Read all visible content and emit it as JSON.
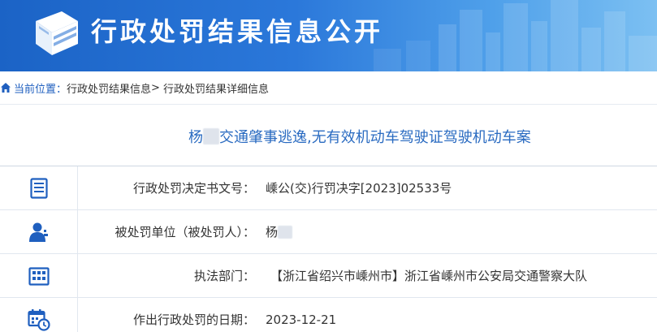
{
  "header": {
    "title": "行政处罚结果信息公开",
    "brand_color": "#1f6bd0"
  },
  "breadcrumb": {
    "prefix": "当前位置：",
    "items": [
      "行政处罚结果信息",
      "行政处罚结果详细信息"
    ],
    "separator": ">"
  },
  "case": {
    "name_prefix": "杨",
    "title_rest": "交通肇事逃逸,无有效机动车驾驶证驾驶机动车案"
  },
  "fields": [
    {
      "icon": "document-list-icon",
      "label": "行政处罚决定书文号：",
      "value": "嵊公(交)行罚决字[2023]02533号"
    },
    {
      "icon": "person-icon",
      "label": "被处罚单位（被处罚人）：",
      "value": "杨"
    },
    {
      "icon": "building-icon",
      "label": "执法部门：",
      "value": "【浙江省绍兴市嵊州市】浙江省嵊州市公安局交通警察大队"
    },
    {
      "icon": "calendar-clock-icon",
      "label": "作出行政处罚的日期：",
      "value": "2023-12-21"
    }
  ]
}
